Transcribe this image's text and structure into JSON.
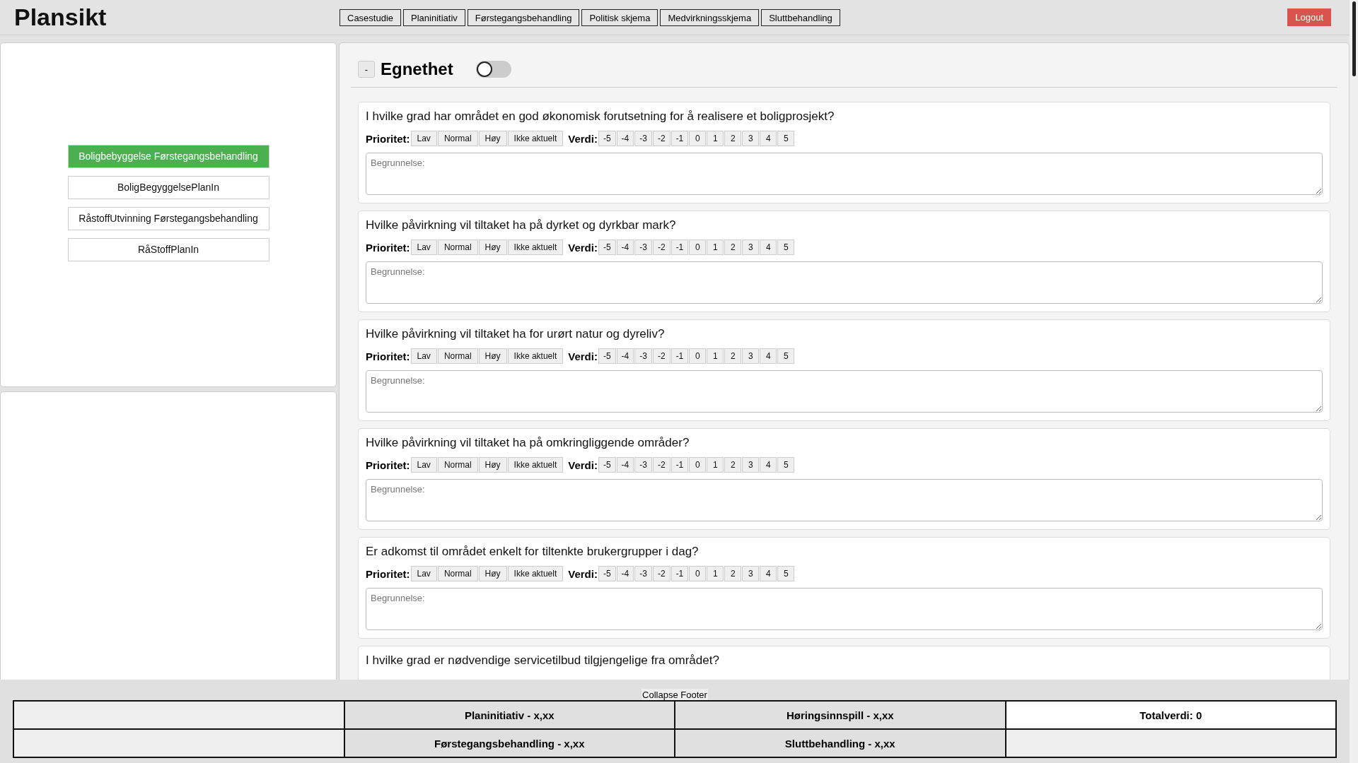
{
  "header": {
    "title": "Plansikt",
    "nav": [
      "Casestudie",
      "Planinitiativ",
      "Førstegangsbehandling",
      "Politisk skjema",
      "Medvirkningsskjema",
      "Sluttbehandling"
    ],
    "logout": "Logout"
  },
  "sidebar": {
    "items": [
      {
        "label": "Boligbebyggelse Førstegangsbehandling",
        "selected": true
      },
      {
        "label": "BoligBegyggelsePlanIn",
        "selected": false
      },
      {
        "label": "RåstoffUtvinning Førstegangsbehandling",
        "selected": false
      },
      {
        "label": "RåStoffPlanIn",
        "selected": false
      }
    ]
  },
  "section": {
    "collapse": "-",
    "title": "Egnethet",
    "toggle": {
      "on": false
    }
  },
  "questions": [
    {
      "kind": "full",
      "text": "I hvilke grad har området en god økonomisk forutsetning for å realisere et boligprosjekt?",
      "priority_label": "Prioritet:",
      "priorities": [
        "Lav",
        "Normal",
        "Høy",
        "Ikke aktuelt"
      ],
      "value_label": "Verdi:",
      "values": [
        "-5",
        "-4",
        "-3",
        "-2",
        "-1",
        "0",
        "1",
        "2",
        "3",
        "4",
        "5"
      ],
      "placeholder": "Begrunnelse:"
    },
    {
      "kind": "full",
      "text": "Hvilke påvirkning vil tiltaket ha på dyrket og dyrkbar mark?",
      "priority_label": "Prioritet:",
      "priorities": [
        "Lav",
        "Normal",
        "Høy",
        "Ikke aktuelt"
      ],
      "value_label": "Verdi:",
      "values": [
        "-5",
        "-4",
        "-3",
        "-2",
        "-1",
        "0",
        "1",
        "2",
        "3",
        "4",
        "5"
      ],
      "placeholder": "Begrunnelse:"
    },
    {
      "kind": "full",
      "text": "Hvilke påvirkning vil tiltaket ha for urørt natur og dyreliv?",
      "priority_label": "Prioritet:",
      "priorities": [
        "Lav",
        "Normal",
        "Høy",
        "Ikke aktuelt"
      ],
      "value_label": "Verdi:",
      "values": [
        "-5",
        "-4",
        "-3",
        "-2",
        "-1",
        "0",
        "1",
        "2",
        "3",
        "4",
        "5"
      ],
      "placeholder": "Begrunnelse:"
    },
    {
      "kind": "full",
      "text": "Hvilke påvirkning vil tiltaket ha på omkringliggende områder?",
      "priority_label": "Prioritet:",
      "priorities": [
        "Lav",
        "Normal",
        "Høy",
        "Ikke aktuelt"
      ],
      "value_label": "Verdi:",
      "values": [
        "-5",
        "-4",
        "-3",
        "-2",
        "-1",
        "0",
        "1",
        "2",
        "3",
        "4",
        "5"
      ],
      "placeholder": "Begrunnelse:"
    },
    {
      "kind": "full",
      "text": "Er adkomst til området enkelt for tiltenkte brukergrupper i dag?",
      "priority_label": "Prioritet:",
      "priorities": [
        "Lav",
        "Normal",
        "Høy",
        "Ikke aktuelt"
      ],
      "value_label": "Verdi:",
      "values": [
        "-5",
        "-4",
        "-3",
        "-2",
        "-1",
        "0",
        "1",
        "2",
        "3",
        "4",
        "5"
      ],
      "placeholder": "Begrunnelse:"
    },
    {
      "kind": "cut",
      "text": "I hvilke grad er nødvendige servicetilbud tilgjengelige fra området?"
    }
  ],
  "footer": {
    "collapse": "Collapse Footer",
    "rows": [
      [
        {
          "kind": "empty"
        },
        {
          "kind": "score",
          "text": "Planinitiativ - x,xx"
        },
        {
          "kind": "score",
          "text": "Høringsinnspill - x,xx"
        },
        {
          "kind": "total",
          "text": "Totalverdi: 0"
        }
      ],
      [
        {
          "kind": "empty"
        },
        {
          "kind": "score",
          "text": "Førstegangsbehandling - x,xx"
        },
        {
          "kind": "score",
          "text": "Sluttbehandling - x,xx"
        },
        {
          "kind": "empty"
        }
      ]
    ]
  }
}
